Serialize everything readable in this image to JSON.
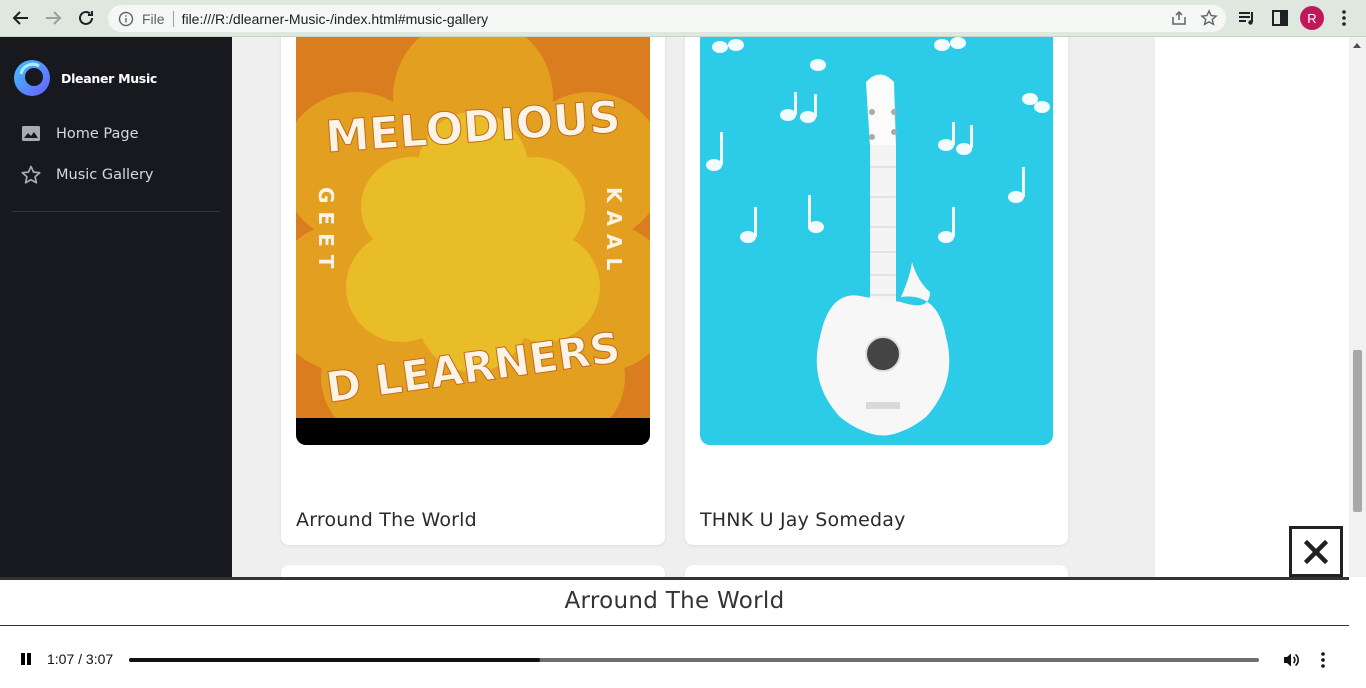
{
  "browser": {
    "file_label": "File",
    "url": "file:///R:/dlearner-Music-/index.html#music-gallery",
    "profile_initial": "R"
  },
  "sidebar": {
    "brand": "Dleaner Music",
    "items": [
      {
        "label": "Home Page",
        "icon": "image-icon"
      },
      {
        "label": "Music Gallery",
        "icon": "star-icon"
      }
    ]
  },
  "gallery": {
    "cards": [
      {
        "title": "Arround The World",
        "art": {
          "top": "MELODIOUS",
          "left": "GEET",
          "right": "KAAL",
          "bottom": "D LEARNERS"
        }
      },
      {
        "title": "THNK U Jay Someday"
      }
    ]
  },
  "player": {
    "now_playing": "Arround The World",
    "time": "1:07 / 3:07",
    "progress_fraction": 0.364
  },
  "colors": {
    "sidebar_bg": "#18191f",
    "art1_orange": "#d97d1f",
    "art1_yellow": "#e6b824",
    "art2_blue": "#2ccbe8"
  }
}
